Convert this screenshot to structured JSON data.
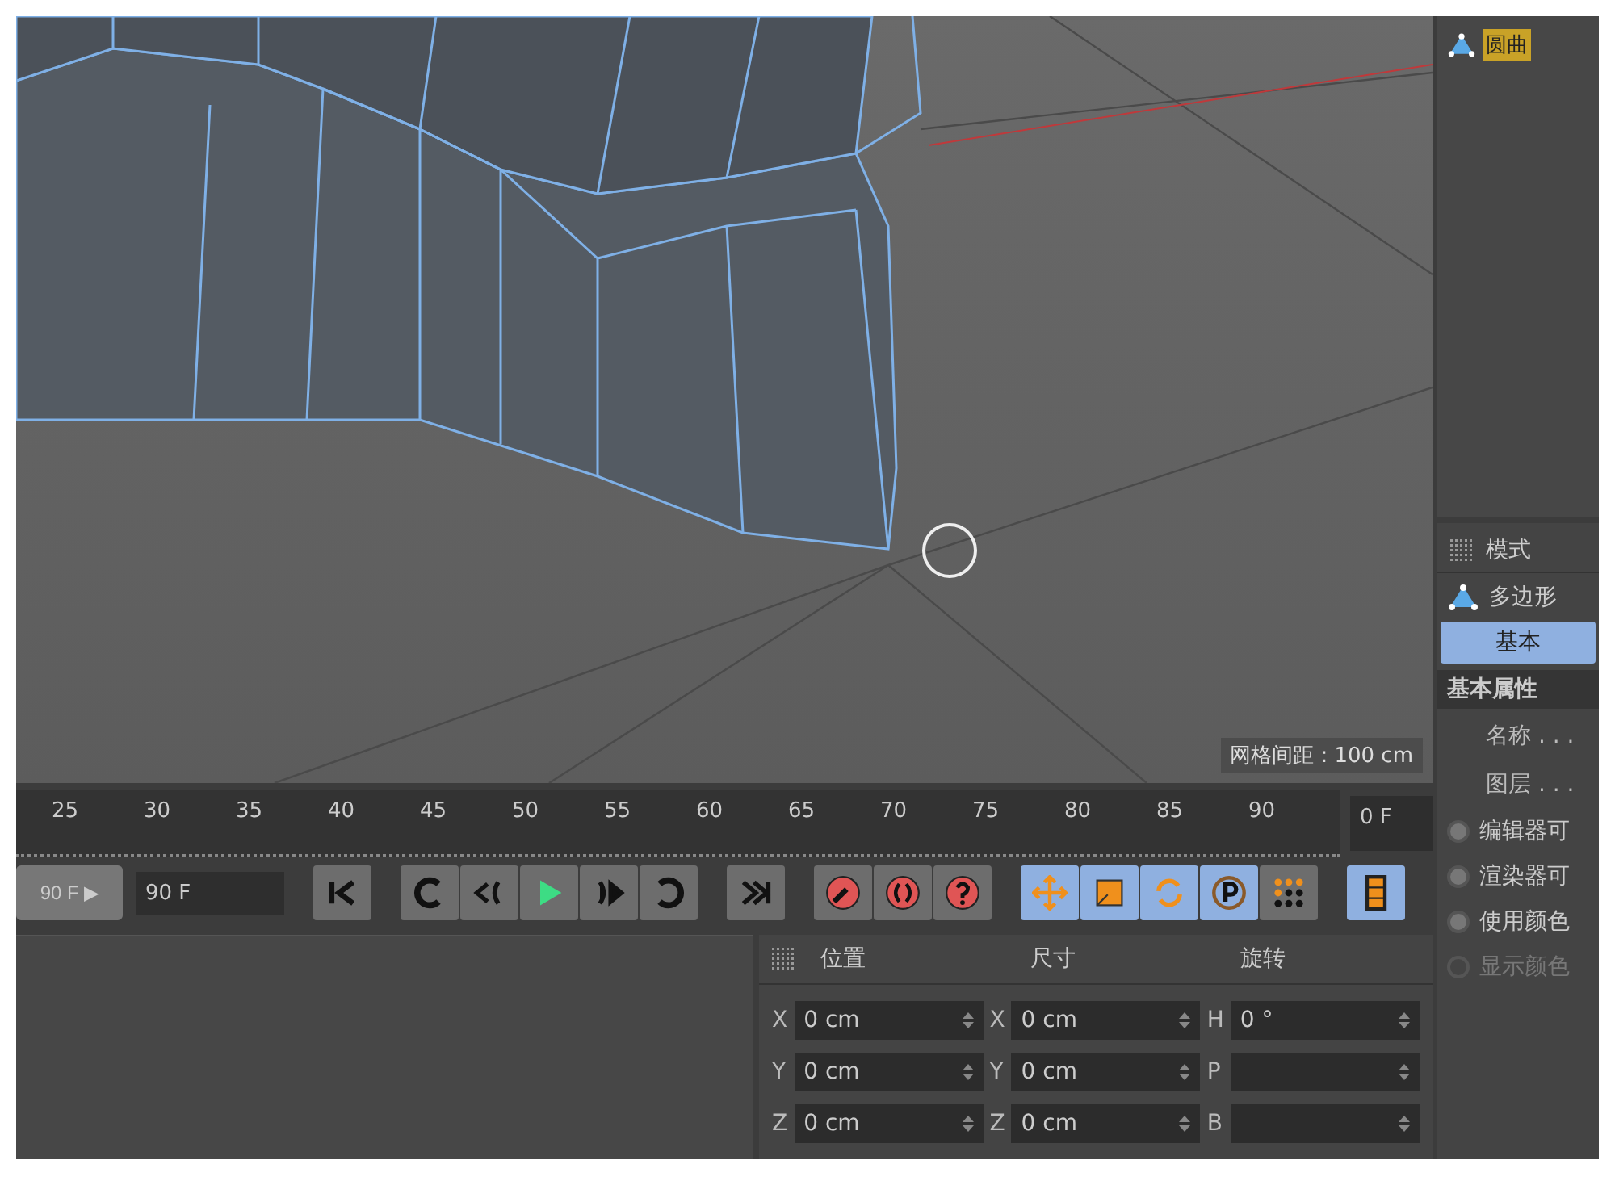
{
  "viewport": {
    "grid_spacing": "网格间距 : 100 cm"
  },
  "object_manager": {
    "items": [
      {
        "label": "圆曲",
        "selected": true
      }
    ]
  },
  "timeline": {
    "ticks": [
      "25",
      "30",
      "35",
      "40",
      "45",
      "50",
      "55",
      "60",
      "65",
      "70",
      "75",
      "80",
      "85",
      "90"
    ],
    "current_frame": "0 F"
  },
  "transport": {
    "end_button": "90 F ▶",
    "end_field": "90 F",
    "groups": [
      [
        {
          "kind": "first",
          "on": false
        }
      ],
      [
        {
          "kind": "back",
          "on": false
        },
        {
          "kind": "prevkey",
          "on": false
        },
        {
          "kind": "play",
          "on": false
        },
        {
          "kind": "nextkey",
          "on": false
        },
        {
          "kind": "loop",
          "on": false
        }
      ],
      [
        {
          "kind": "last",
          "on": false
        }
      ],
      [
        {
          "kind": "key",
          "on": false
        },
        {
          "kind": "autokey",
          "on": false
        },
        {
          "kind": "help",
          "on": false
        }
      ],
      [
        {
          "kind": "move",
          "on": true
        },
        {
          "kind": "scale",
          "on": true
        },
        {
          "kind": "rotate",
          "on": true
        },
        {
          "kind": "param",
          "on": true
        },
        {
          "kind": "dots",
          "on": false
        }
      ],
      [
        {
          "kind": "film",
          "on": true
        }
      ]
    ]
  },
  "coordinates": {
    "headers": [
      "位置",
      "尺寸",
      "旋转"
    ],
    "rows": [
      [
        {
          "axis": "X",
          "value": "0 cm"
        },
        {
          "axis": "X",
          "value": "0 cm"
        },
        {
          "axis": "H",
          "value": "0 °"
        }
      ],
      [
        {
          "axis": "Y",
          "value": "0 cm"
        },
        {
          "axis": "Y",
          "value": "0 cm"
        },
        {
          "axis": "P"
        }
      ],
      [
        {
          "axis": "Z",
          "value": "0 cm"
        },
        {
          "axis": "Z",
          "value": "0 cm"
        },
        {
          "axis": "B"
        }
      ]
    ]
  },
  "attributes": {
    "menu": [
      "模式"
    ],
    "object_type": "多边形",
    "tabs": [
      {
        "label": "基本",
        "selected": true
      }
    ],
    "section": "基本属性",
    "fields": [
      {
        "kind": "text",
        "label": "名称 . . ."
      },
      {
        "kind": "text",
        "label": "图层 . . ."
      },
      {
        "kind": "radio",
        "label": "编辑器可",
        "disabled": false
      },
      {
        "kind": "radio",
        "label": "渲染器可",
        "disabled": false
      },
      {
        "kind": "radio",
        "label": "使用颜色",
        "disabled": false
      },
      {
        "kind": "radio",
        "label": "显示颜色",
        "disabled": true
      }
    ]
  }
}
